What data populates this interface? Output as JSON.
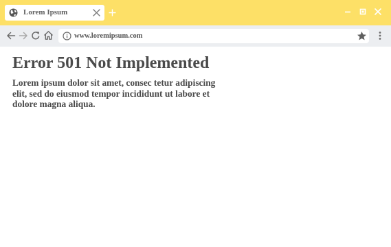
{
  "tab": {
    "title": "Lorem Ipsum",
    "favicon": "globe-icon"
  },
  "window_controls": [
    "minimize-icon",
    "maximize-icon",
    "close-icon"
  ],
  "address_bar": {
    "url": "www.loremipsum.com",
    "info_icon": "info-icon",
    "bookmark_icon": "star-icon"
  },
  "navigation": [
    "back-arrow-icon",
    "forward-arrow-icon",
    "reload-icon",
    "home-icon"
  ],
  "page": {
    "heading": "Error 501 Not Implemented",
    "body": "Lorem ipsum dolor sit amet, consec tetur adipiscing elit, sed do eiusmod tempor incididunt ut labore et dolore magna aliqua."
  },
  "colors": {
    "titlebar": "#fde067",
    "toolbar": "#eceef1",
    "text": "#4a4a4a",
    "icon": "#6b6b6b"
  }
}
